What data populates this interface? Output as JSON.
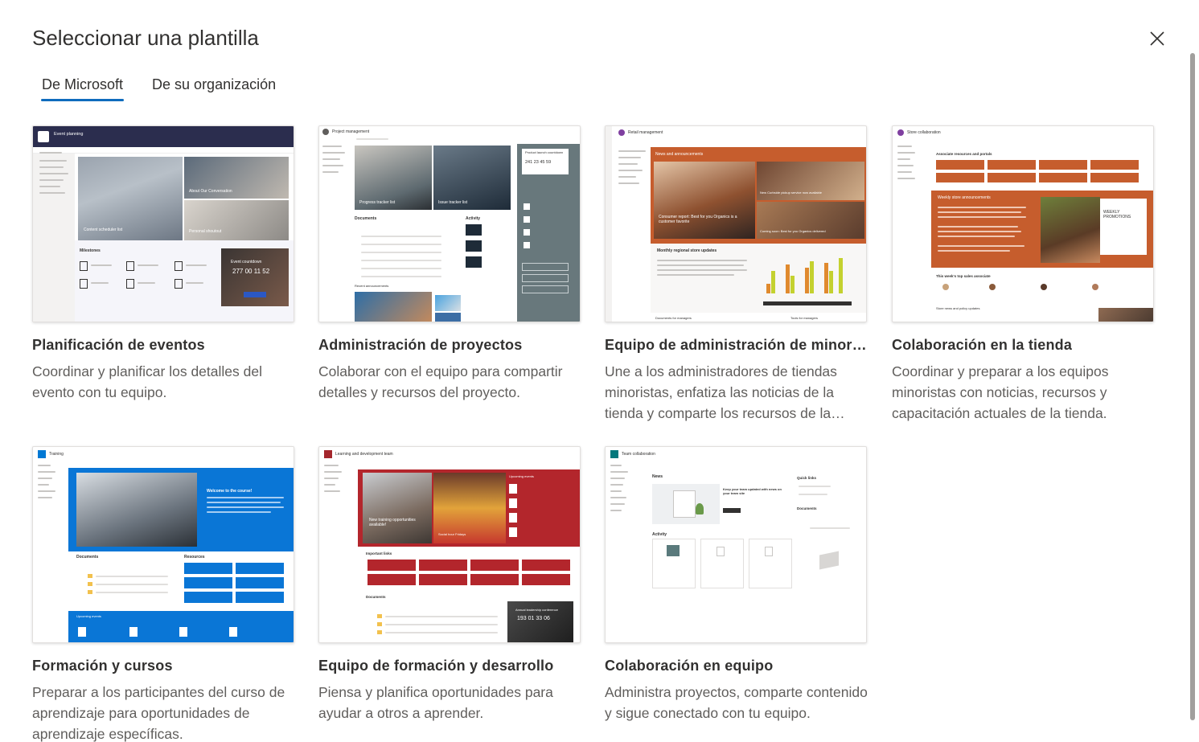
{
  "dialog": {
    "title": "Seleccionar una plantilla",
    "close_icon": "close-icon"
  },
  "tabs": [
    {
      "label": "De Microsoft",
      "selected": true
    },
    {
      "label": "De su organización",
      "selected": false
    }
  ],
  "templates": [
    {
      "title": "Planificación de eventos",
      "description": "Coordinar y planificar los detalles del evento con tu equipo.",
      "thumb": {
        "site_name": "Event planning",
        "tiles": [
          "Content scheduler list",
          "About Our Conversation",
          "Personal shoutout"
        ],
        "milestones": "Milestones",
        "countdown": "Event countdown",
        "countdown_values": [
          "277",
          "00",
          "11",
          "52"
        ]
      }
    },
    {
      "title": "Administración de proyectos",
      "description": "Colaborar con el equipo para compartir detalles y recursos del proyecto.",
      "thumb": {
        "site_name": "Project management",
        "tiles": [
          "Progress tracker list",
          "Issue tracker list"
        ],
        "launch_title": "Product launch countdown",
        "launch_values": [
          "241",
          "23",
          "45",
          "59"
        ],
        "documents": "Documents",
        "activity": "Activity",
        "announcements": "Recent announcements"
      }
    },
    {
      "title": "Equipo de administración de minoristas",
      "description": "Une a los administradores de tiendas minoristas, enfatiza las noticias de la tienda y comparte los recursos de la tienda.",
      "thumb": {
        "site_name": "Retail management",
        "news": "News and announcements",
        "hero_caption": "Consumer report: Best for you Organics is a customer favorite",
        "side_caption": "New Curbside pickup service now available",
        "side_caption2": "Coming soon: Best for you Organics delivered",
        "monthly": "Monthly regional store updates",
        "docs": "Documents for managers",
        "tools": "Tools for managers"
      }
    },
    {
      "title": "Colaboración en la tienda",
      "description": "Coordinar y preparar a los equipos minoristas con noticias, recursos y capacitación actuales de la tienda.",
      "thumb": {
        "site_name": "Store collaboration",
        "resources": "Associate resources and portals",
        "weekly": "Weekly store announcements",
        "promo": "WEEKLY PROMOTIONS",
        "top_sales": "This week's top sales associate",
        "store_news": "Store news and policy updates"
      }
    },
    {
      "title": "Formación y cursos",
      "description": "Preparar a los participantes del curso de aprendizaje para oportunidades de aprendizaje específicas.",
      "thumb": {
        "site_name": "Training",
        "welcome": "Welcome to the course!",
        "documents": "Documents",
        "resources": "Resources",
        "upcoming": "Upcoming events"
      }
    },
    {
      "title": "Equipo de formación y desarrollo",
      "description": "Piensa y planifica oportunidades para ayudar a otros a aprender.",
      "thumb": {
        "site_name": "Learning and development team",
        "hero_caption": "New training opportunities available!",
        "caption2": "Social hour Fridays",
        "upcoming": "Upcoming events",
        "important": "Important links",
        "documents": "Documents",
        "conference": "Annual leadership conference",
        "conference_values": [
          "193",
          "01",
          "33",
          "06"
        ]
      }
    },
    {
      "title": "Colaboración en equipo",
      "description": "Administra proyectos, comparte contenido y sigue conectado con tu equipo.",
      "thumb": {
        "site_name": "Team collaboration",
        "news": "News",
        "news_title": "Keep your team updated with news on your team site",
        "quick_links": "Quick links",
        "documents": "Documents",
        "activity": "Activity"
      }
    }
  ]
}
